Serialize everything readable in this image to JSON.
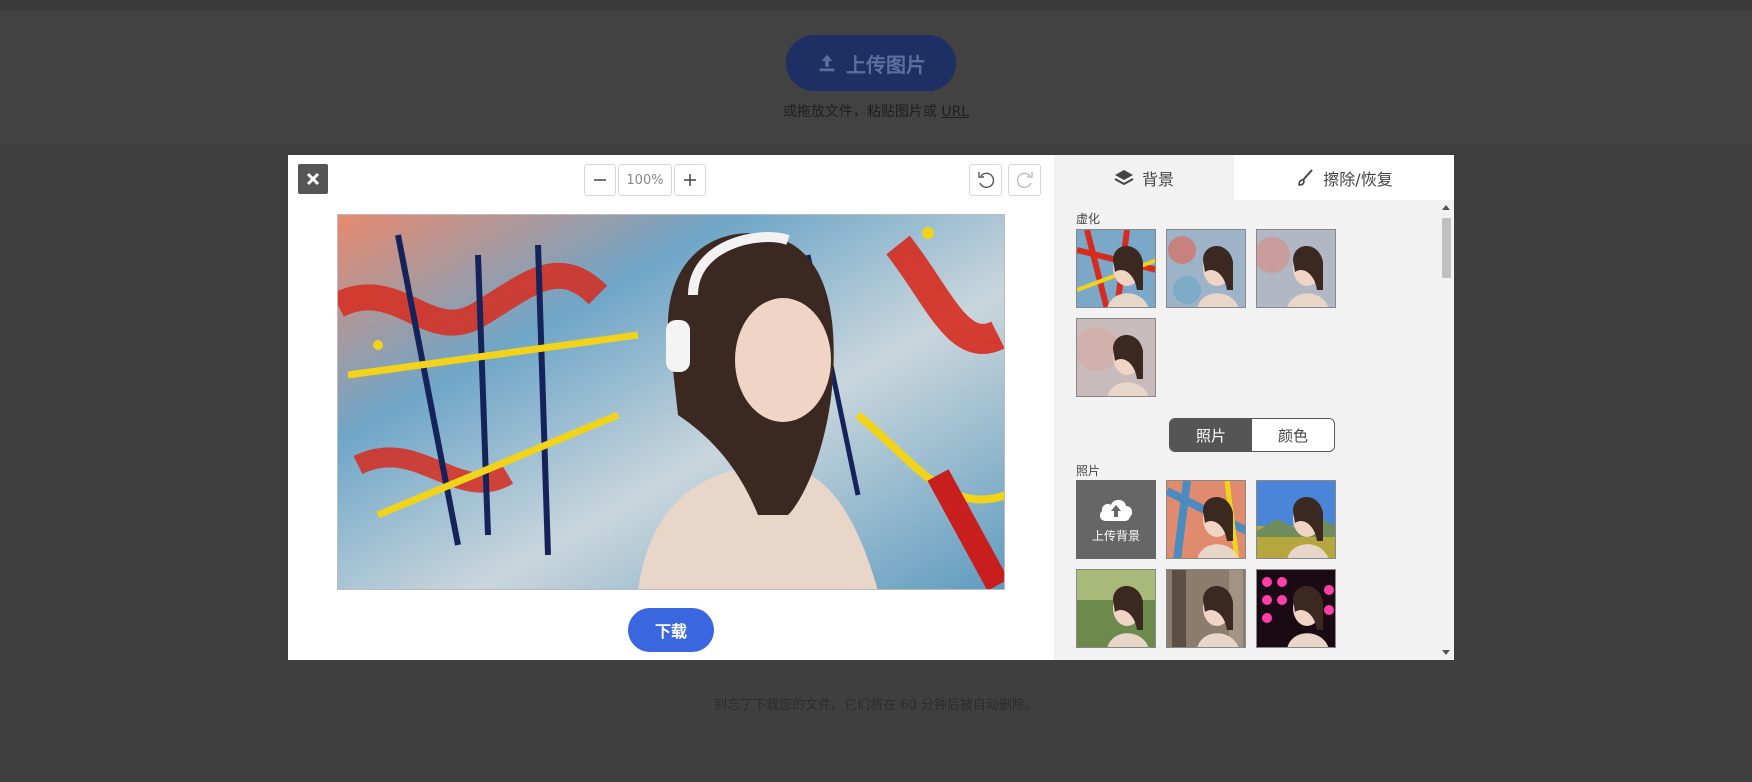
{
  "background_page": {
    "upload_button_label": "上传图片",
    "hint_text": "或拖放文件，粘贴图片或 ",
    "hint_link": "URL",
    "footer_note": "别忘了下载您的文件。它们将在 60 分钟后被自动删除。"
  },
  "editor": {
    "zoom_value": "100%",
    "download_label": "下载"
  },
  "panel": {
    "tabs": [
      {
        "label": "背景",
        "icon": "layers-icon",
        "active": true
      },
      {
        "label": "擦除/恢复",
        "icon": "brush-icon",
        "active": false
      }
    ],
    "blur_section_label": "虚化",
    "segment": {
      "photo": "照片",
      "color": "颜色",
      "selected": "照片"
    },
    "photo_section_label": "照片",
    "upload_background_label": "上传背景"
  },
  "colors": {
    "accent": "#3a66e0",
    "overlay": "#3f3f3f",
    "panel_bg": "#f2f2f2"
  }
}
